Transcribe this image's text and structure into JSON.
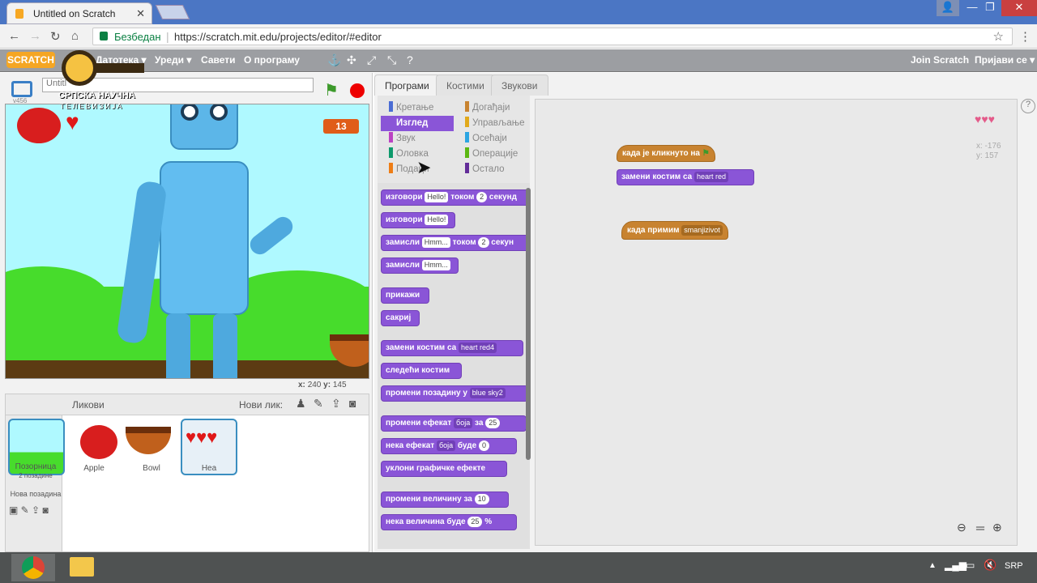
{
  "browser": {
    "tab_title": "Untitled on Scratch",
    "secure_label": "Безбедан",
    "url": "https://scratch.mit.edu/projects/editor/#editor"
  },
  "menubar": {
    "logo": "SCRATCH",
    "items": [
      "Датотека ▾",
      "Уреди ▾",
      "Савети",
      "О програму"
    ],
    "join": "Join Scratch",
    "signin": "Пријави се ▾"
  },
  "watermark": {
    "line1": "СРПСКА НАУЧНА",
    "line2": "ТЕЛЕВИЗИЈА"
  },
  "stage": {
    "title_value": "Untitl",
    "version": "v456",
    "score": "13",
    "x_label": "x:",
    "x_value": "240",
    "y_label": "y:",
    "y_value": "145"
  },
  "sprites": {
    "header": "Ликови",
    "new_sprite": "Нови лик:",
    "stage_label": "Позорница",
    "stage_sub": "2 позадине",
    "new_backdrop": "Нова позадина",
    "items": [
      "Apple",
      "Bowl",
      "Hea"
    ]
  },
  "tabs": [
    "Програми",
    "Костими",
    "Звукови"
  ],
  "categories_left": [
    "Кретање",
    "Изглед",
    "Звук",
    "Оловка",
    "Подаци"
  ],
  "categories_right": [
    "Догађаји",
    "Управљање",
    "Осећаји",
    "Операције",
    "Остало"
  ],
  "category_colors": {
    "left": [
      "#4a6cd4",
      "#8a55d7",
      "#bb42c3",
      "#0e9a6c",
      "#ee7d16"
    ],
    "right": [
      "#c88330",
      "#e1a91a",
      "#2ca5e2",
      "#5cb712",
      "#632d99"
    ]
  },
  "palette_blocks": {
    "say_timed": {
      "a": "изговори",
      "input": "Hello!",
      "b": "током",
      "num": "2",
      "c": "секунд"
    },
    "say": {
      "a": "изговори",
      "input": "Hello!"
    },
    "think_timed": {
      "a": "замисли",
      "input": "Hmm...",
      "b": "током",
      "num": "2",
      "c": "секун"
    },
    "think": {
      "a": "замисли",
      "input": "Hmm..."
    },
    "show": "прикажи",
    "hide": "сакриј",
    "switch_costume": {
      "a": "замени костим са",
      "dd": "heart red4"
    },
    "next_costume": "следећи костим",
    "switch_backdrop": {
      "a": "промени позадину у",
      "dd": "blue sky2"
    },
    "change_effect": {
      "a": "промени ефекат",
      "dd": "боја",
      "b": "за",
      "num": "25"
    },
    "set_effect": {
      "a": "нека ефекат",
      "dd": "боја",
      "b": "буде",
      "num": "0"
    },
    "clear_effects": "уклони графичке ефекте",
    "change_size": {
      "a": "промени величину за",
      "num": "10"
    },
    "set_size": {
      "a": "нека величина буде",
      "num": "25",
      "b": "%"
    }
  },
  "script_area": {
    "hat1": "када је кликнуто на",
    "switch": {
      "a": "замени костим са",
      "dd": "heart red"
    },
    "hat2": {
      "a": "када примим",
      "dd": "smanjizivot"
    },
    "x_readout": "x: -176",
    "y_readout": "y: 157"
  },
  "taskbar": {
    "lang": "SRP"
  }
}
